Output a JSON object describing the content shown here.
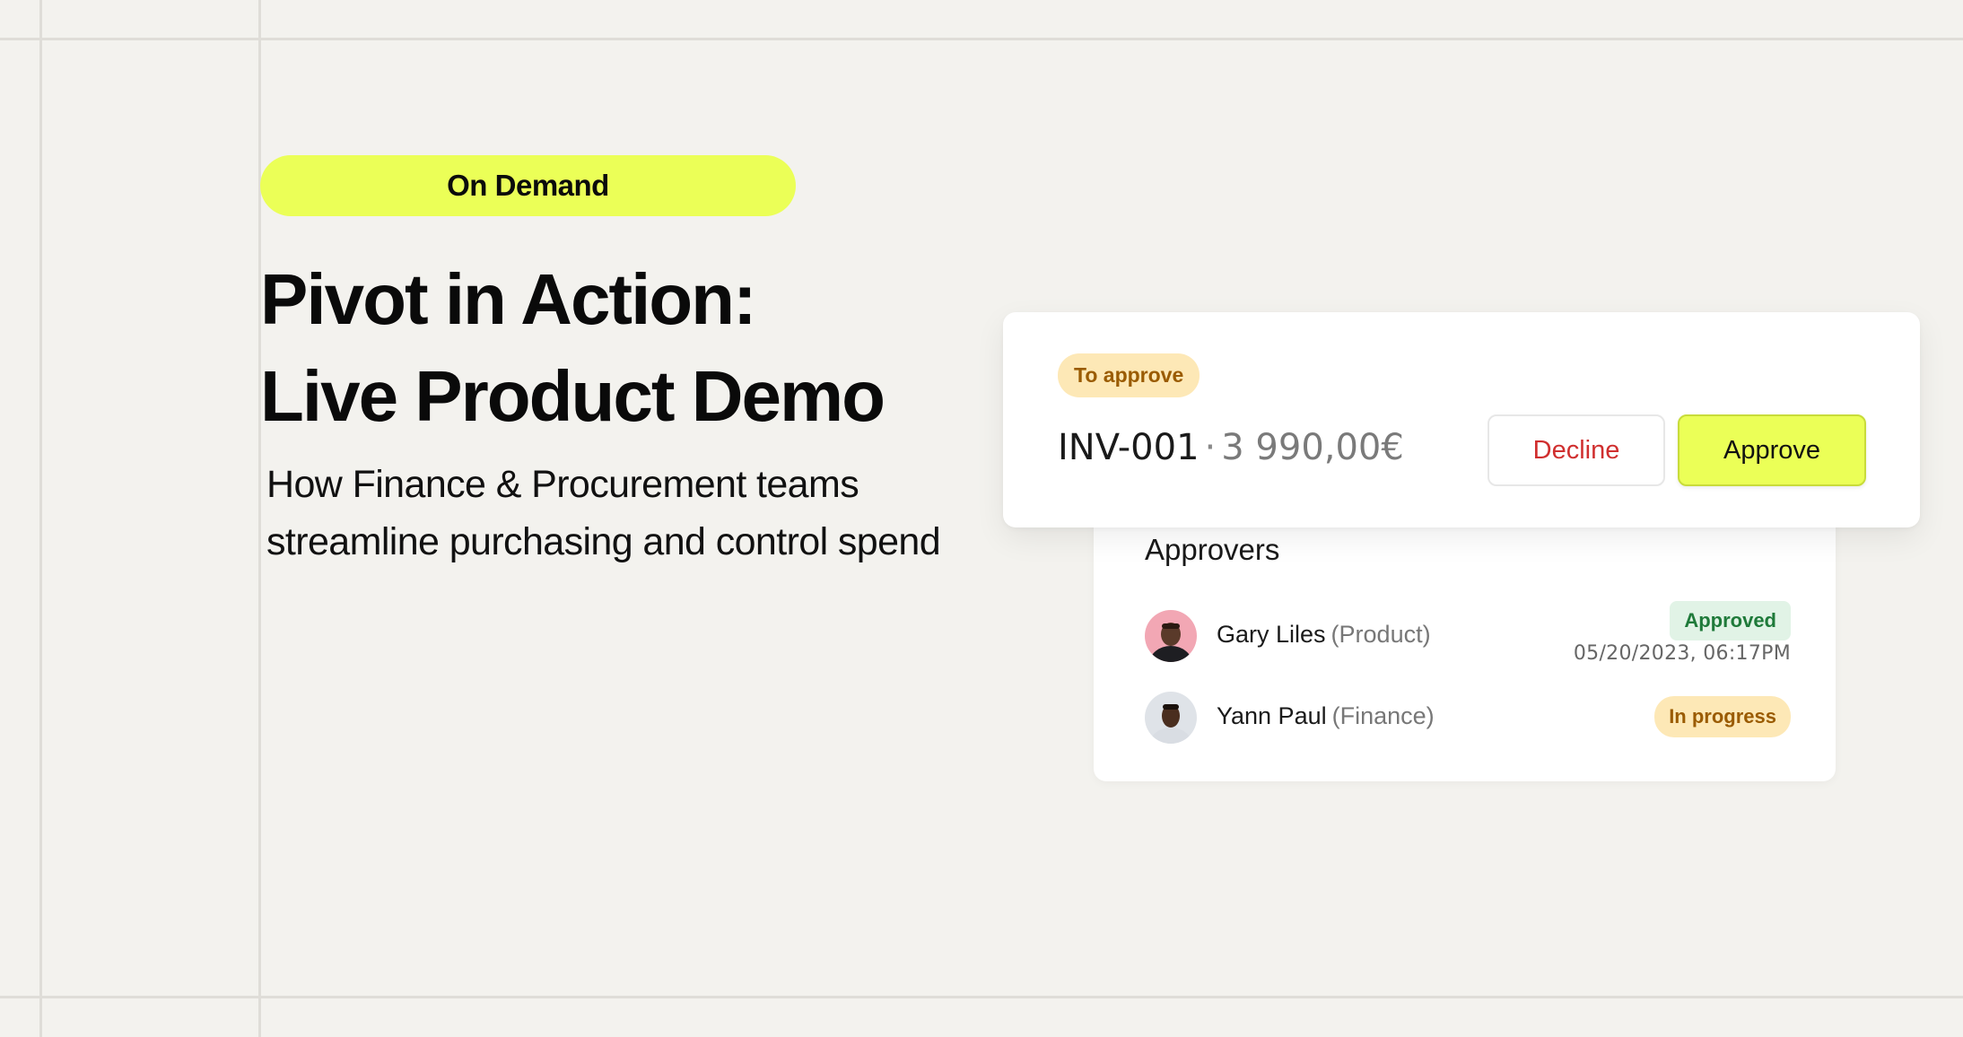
{
  "badge": {
    "label": "On Demand"
  },
  "headline": {
    "line1": "Pivot in Action:",
    "line2": "Live Product Demo"
  },
  "subtitle": {
    "line1": "How Finance & Procurement teams",
    "line2": "streamline purchasing and control spend"
  },
  "invoice": {
    "status": "To approve",
    "id": "INV-001",
    "separator": "·",
    "amount": "3 990,00€",
    "decline_label": "Decline",
    "approve_label": "Approve"
  },
  "approvers": {
    "title": "Approvers",
    "items": [
      {
        "name": "Gary Liles",
        "dept": "(Product)",
        "status": "Approved",
        "date": "05/20/2023, 06:17PM"
      },
      {
        "name": "Yann Paul",
        "dept": "(Finance)",
        "status": "In progress"
      }
    ]
  },
  "colors": {
    "background": "#f3f2ee",
    "accent": "#ebff57",
    "decline_text": "#d02f2f",
    "approved_bg": "#e1f3e6",
    "pending_bg": "#fde8b6"
  }
}
